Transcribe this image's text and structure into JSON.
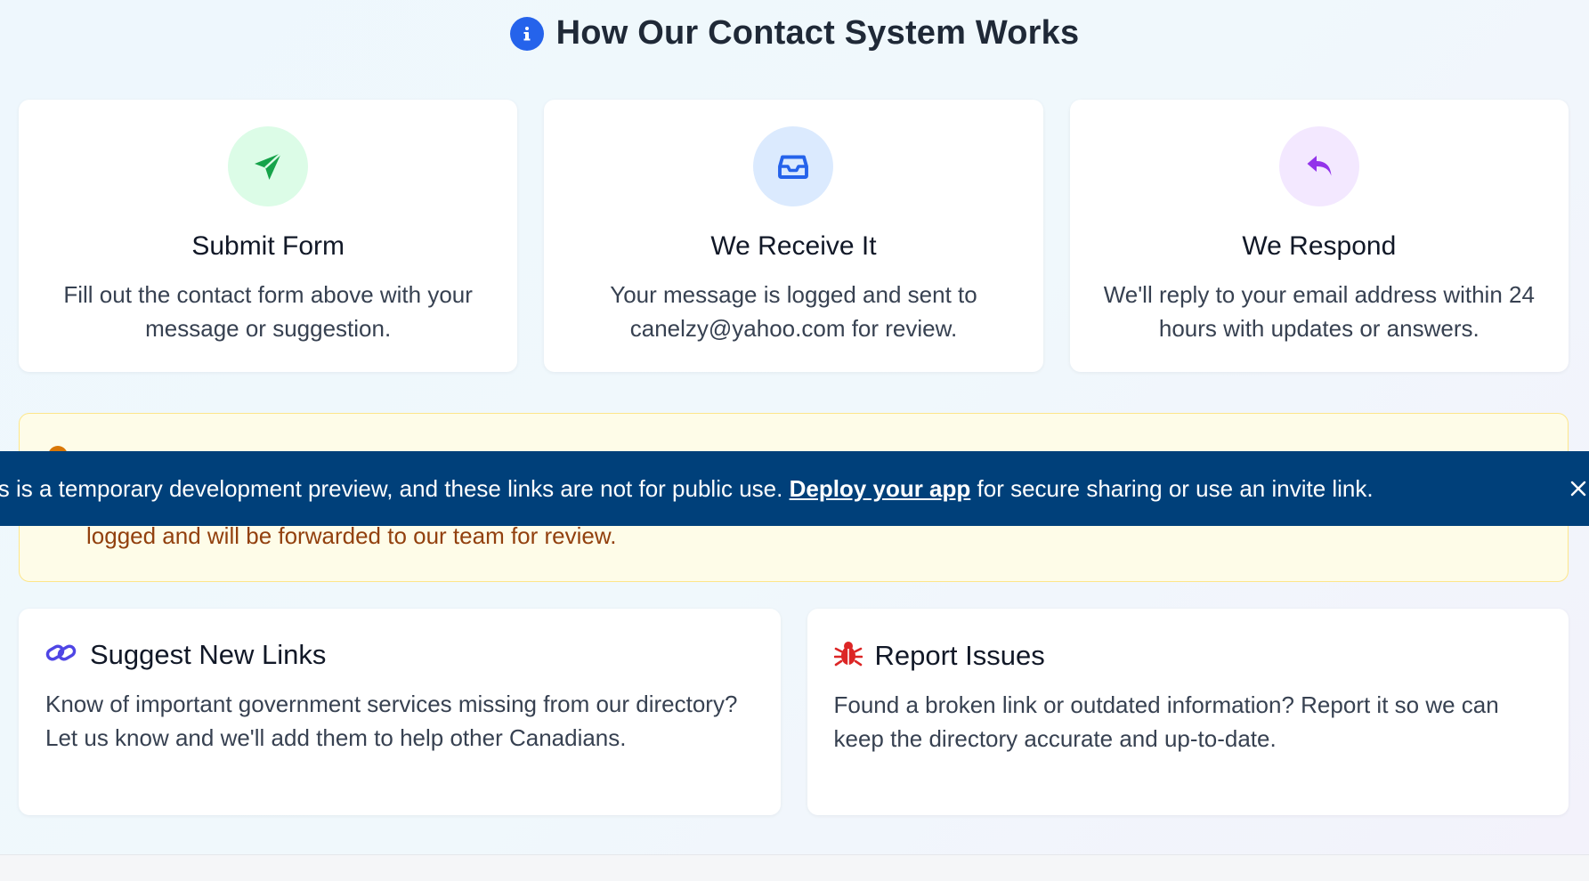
{
  "section": {
    "title": "How Our Contact System Works",
    "icon": "info-icon"
  },
  "steps": [
    {
      "title": "Submit Form",
      "description": "Fill out the contact form above with your message or suggestion.",
      "icon": "paper-plane-icon",
      "icon_color": "#16a34a",
      "icon_bg": "#dcfce7"
    },
    {
      "title": "We Receive It",
      "description": "Your message is logged and sent to canelzy@yahoo.com for review.",
      "icon": "inbox-icon",
      "icon_color": "#2563eb",
      "icon_bg": "#dbeafe"
    },
    {
      "title": "We Respond",
      "description": "We'll reply to your email address within 24 hours with updates or answers.",
      "icon": "reply-icon",
      "icon_color": "#9333ea",
      "icon_bg": "#f3e8ff"
    }
  ],
  "notice": {
    "text": "logged and will be forwarded to our team for review.",
    "color": "#92400e"
  },
  "banner": {
    "text_before": "is is a temporary development preview, and these links are not for public use. ",
    "link": "Deploy your app",
    "text_after": " for secure sharing or use an invite link.",
    "color": "#00407a"
  },
  "features": [
    {
      "title": "Suggest New Links",
      "description": "Know of important government services missing from our directory? Let us know and we'll add them to help other Canadians.",
      "icon": "link-icon",
      "icon_color": "#4f46e5"
    },
    {
      "title": "Report Issues",
      "description": "Found a broken link or outdated information? Report it so we can keep the directory accurate and up-to-date.",
      "icon": "bug-icon",
      "icon_color": "#dc2626"
    }
  ]
}
